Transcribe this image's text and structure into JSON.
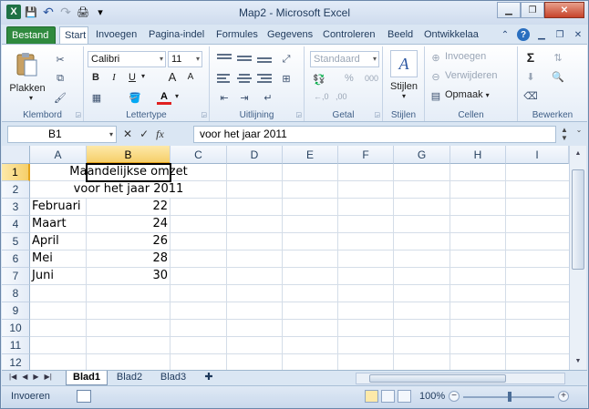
{
  "window": {
    "title": "Map2 - Microsoft Excel"
  },
  "qat": {
    "app_icon": "X",
    "save": "💾",
    "undo": "↶",
    "redo": "↷",
    "print": "🖨",
    "customize": "▾"
  },
  "ribbon_tabs": [
    "Bestand",
    "Start",
    "Invoegen",
    "Pagina-indel",
    "Formules",
    "Gegevens",
    "Controleren",
    "Beeld",
    "Ontwikkelaa"
  ],
  "ribbon": {
    "clipboard": {
      "label": "Klembord",
      "paste": "Plakken"
    },
    "font": {
      "label": "Lettertype",
      "name": "Calibri",
      "size": "11",
      "bold": "B",
      "italic": "I",
      "underline": "U",
      "grow": "A",
      "shrink": "A",
      "color": "A"
    },
    "alignment": {
      "label": "Uitlijning"
    },
    "number": {
      "label": "Getal",
      "format": "Standaard",
      "percent": "%",
      "thousands": "000"
    },
    "styles": {
      "label": "Stijlen",
      "button": "Stijlen"
    },
    "cells": {
      "label": "Cellen",
      "insert": "Invoegen",
      "delete": "Verwijderen",
      "format": "Opmaak"
    },
    "editing": {
      "label": "Bewerken"
    }
  },
  "formula_bar": {
    "name_box": "B1",
    "fx": "fx",
    "content": "voor het jaar 2011"
  },
  "columns": [
    "A",
    "B",
    "C",
    "D",
    "E",
    "F",
    "G",
    "H",
    "I"
  ],
  "rows": [
    "1",
    "2",
    "3",
    "4",
    "5",
    "6",
    "7",
    "8",
    "9",
    "10",
    "11",
    "12"
  ],
  "cells": {
    "b1": "Maandelijkse omzet",
    "b2": "voor het jaar 2011",
    "a3": "Februari",
    "b3": "22",
    "a4": "Maart",
    "b4": "24",
    "a5": "April",
    "b5": "26",
    "a6": "Mei",
    "b6": "28",
    "a7": "Juni",
    "b7": "30"
  },
  "sheet_tabs": [
    "Blad1",
    "Blad2",
    "Blad3"
  ],
  "status": {
    "mode": "Invoeren",
    "zoom": "100%"
  },
  "colors": {
    "file_tab": "#2f8a3e",
    "selection_header": "#f6cf6a",
    "ribbon_bg": "#dae6f3"
  }
}
